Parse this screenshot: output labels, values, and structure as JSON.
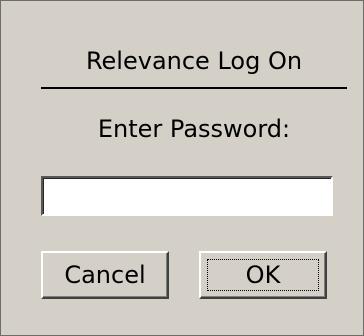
{
  "dialog": {
    "title": "Relevance Log On",
    "prompt": "Enter Password:",
    "password": {
      "value": "",
      "placeholder": ""
    },
    "buttons": {
      "cancel_label": "Cancel",
      "ok_label": "OK"
    }
  },
  "colors": {
    "background": "#d4d0c8",
    "field_background": "#ffffff",
    "text": "#000000"
  }
}
